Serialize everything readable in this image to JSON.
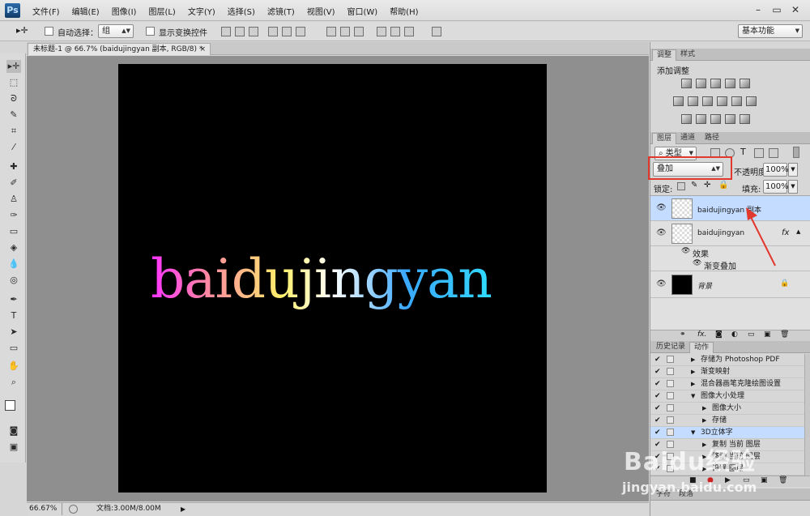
{
  "app": {
    "logo": "Ps"
  },
  "menu": [
    "文件(F)",
    "编辑(E)",
    "图像(I)",
    "图层(L)",
    "文字(Y)",
    "选择(S)",
    "滤镜(T)",
    "视图(V)",
    "窗口(W)",
    "帮助(H)"
  ],
  "window_controls": {
    "minimize": "–",
    "restore": "▭",
    "close": "✕"
  },
  "options": {
    "auto_select_label": "自动选择：",
    "auto_select_value": "组",
    "show_transform_label": "显示变换控件",
    "workspace": "基本功能"
  },
  "document": {
    "tab_title": "未标题-1 @ 66.7% (baidujingyan 副本, RGB/8) *",
    "tab_close": "×",
    "artwork_text": "baidujingyan"
  },
  "status": {
    "zoom": "66.67%",
    "doc_info": "文档:3.00M/8.00M"
  },
  "adjust_panel": {
    "tabs": [
      "调整",
      "样式"
    ],
    "title": "添加调整"
  },
  "layers_panel": {
    "tabs": [
      "图层",
      "通道",
      "路径"
    ],
    "filter_type": "类型",
    "blend_mode": "叠加",
    "opacity_label": "不透明度:",
    "opacity_value": "100%",
    "lock_label": "锁定:",
    "fill_label": "填充:",
    "fill_value": "100%",
    "layers": [
      {
        "name": "baidujingyan 副本",
        "selected": true
      },
      {
        "name": "baidujingyan",
        "fx": "fx"
      },
      {
        "name": "背景",
        "locked": true
      }
    ],
    "effects_label": "效果",
    "effect_item": "渐变叠加"
  },
  "actions_panel": {
    "tabs": [
      "历史记录",
      "动作"
    ],
    "rows": [
      {
        "label": "存储为 Photoshop PDF",
        "indent": 1
      },
      {
        "label": "渐变映射",
        "indent": 1
      },
      {
        "label": "混合器画笔克隆绘图设置",
        "indent": 1
      },
      {
        "label": "图像大小处理",
        "indent": 1,
        "open": true
      },
      {
        "label": "图像大小",
        "indent": 2
      },
      {
        "label": "存储",
        "indent": 2
      },
      {
        "label": "3D立体字",
        "indent": 1,
        "open": true,
        "selected": true
      },
      {
        "label": "复制 当前 图层",
        "indent": 2
      },
      {
        "label": "移动 当前 图层",
        "indent": 2
      },
      {
        "label": "设置 图层",
        "indent": 2
      }
    ]
  },
  "bottom_tabs": [
    "字符",
    "段落"
  ],
  "watermark": {
    "line1": "Baidu经验",
    "line2": "jingyan.baidu.com"
  },
  "colors": {
    "annotation_red": "#e2392f",
    "selected_layer": "#c4dcff"
  }
}
